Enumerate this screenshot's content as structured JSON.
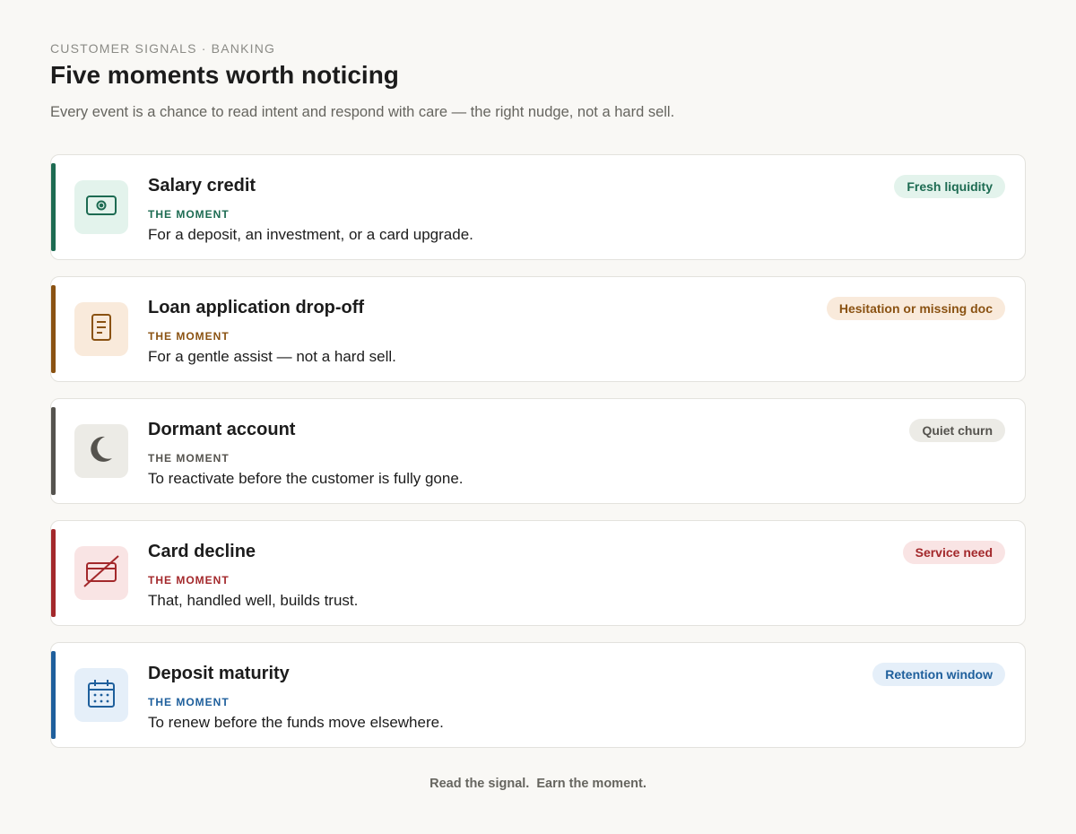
{
  "header": {
    "eyebrow": "CUSTOMER SIGNALS · BANKING",
    "title": "Five moments worth noticing",
    "subtitle": "Every event is a chance to read intent and respond with care — the right nudge, not a hard sell."
  },
  "moment_label": "THE MOMENT",
  "signals": [
    {
      "name": "Salary credit",
      "badge": "Fresh liquidity",
      "moment": "For a deposit, an investment, or a card upgrade.",
      "icon": "cash-icon",
      "accent": "#1d6b52",
      "tint": "#e3f3ec"
    },
    {
      "name": "Loan application drop-off",
      "badge": "Hesitation or missing doc",
      "moment": "For a gentle assist — not a hard sell.",
      "icon": "document-icon",
      "accent": "#8a5212",
      "tint": "#f9eadb"
    },
    {
      "name": "Dormant account",
      "badge": "Quiet churn",
      "moment": "To reactivate before the customer is fully gone.",
      "icon": "moon-icon",
      "accent": "#55534e",
      "tint": "#ecebe6"
    },
    {
      "name": "Card decline",
      "badge": "Service need",
      "moment": "That, handled well, builds trust.",
      "icon": "card-declined-icon",
      "accent": "#a3282b",
      "tint": "#f9e4e4"
    },
    {
      "name": "Deposit maturity",
      "badge": "Retention window",
      "moment": "To renew before the funds move elsewhere.",
      "icon": "calendar-icon",
      "accent": "#1e5f9c",
      "tint": "#e5eff9"
    }
  ],
  "footer": "Read the signal.  Earn the moment."
}
